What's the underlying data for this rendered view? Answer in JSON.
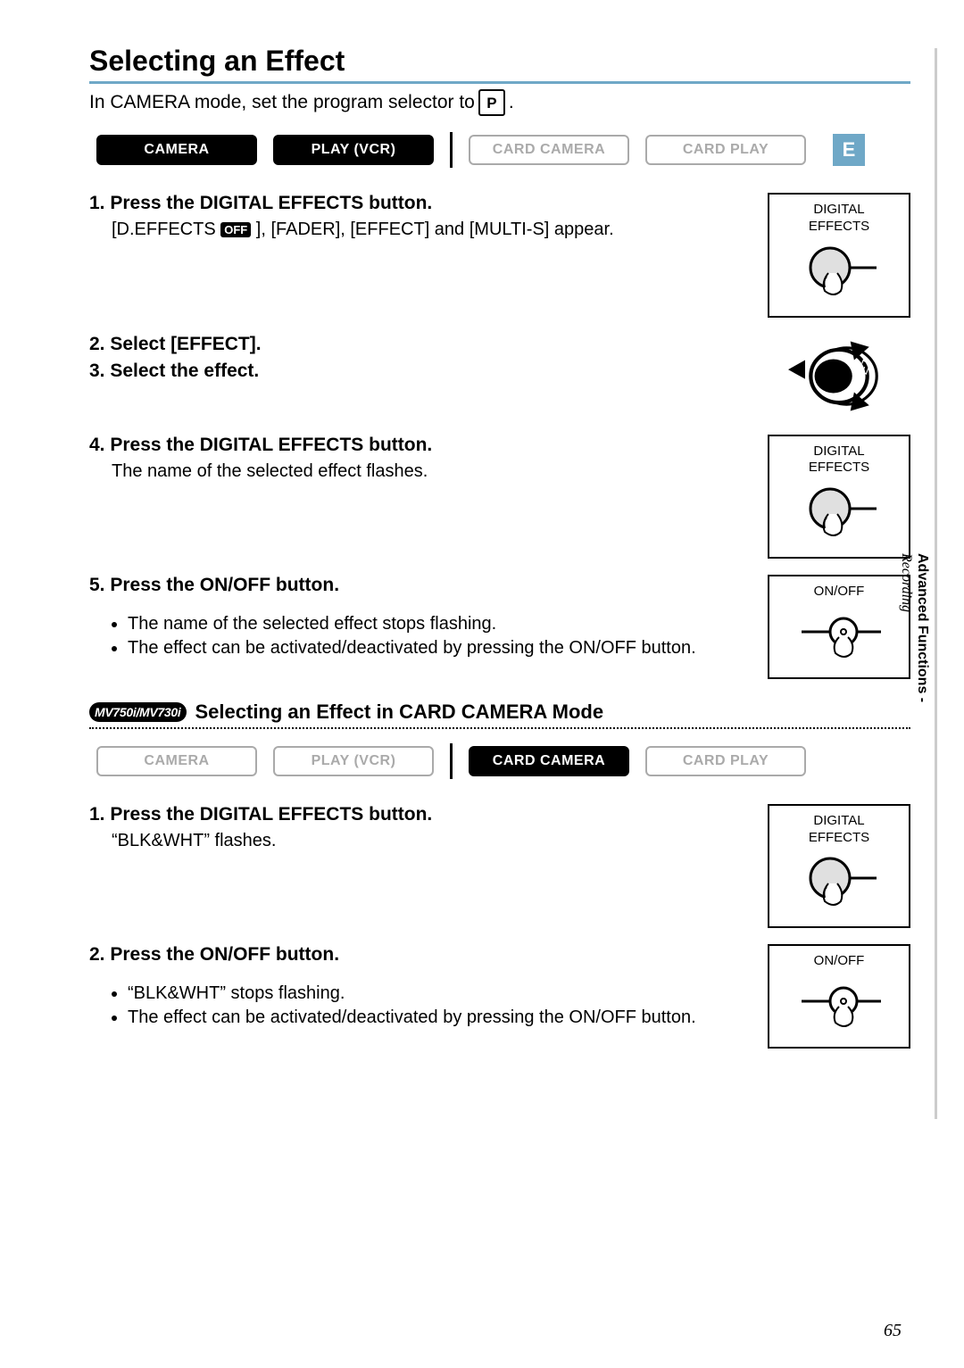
{
  "title": "Selecting an Effect",
  "intro_prefix": "In CAMERA mode, set the program selector to ",
  "intro_chip": "P",
  "intro_suffix": ".",
  "e_chip": "E",
  "modes_top": [
    {
      "label": "CAMERA",
      "active": true
    },
    {
      "label": "PLAY (VCR)",
      "active": true
    },
    {
      "label": "CARD CAMERA",
      "active": false
    },
    {
      "label": "CARD PLAY",
      "active": false
    }
  ],
  "steps_top": [
    {
      "num": "1.",
      "head": "Press the DIGITAL EFFECTS button.",
      "desc_prefix": "[D.EFFECTS ",
      "desc_off": "OFF",
      "desc_suffix": " ], [FADER], [EFFECT] and [MULTI-S] appear.",
      "illus": {
        "label1": "DIGITAL",
        "label2": "EFFECTS",
        "type": "press"
      }
    },
    {
      "num": "2.",
      "head": "Select [EFFECT]."
    },
    {
      "num": "3.",
      "head": "Select the effect.",
      "illus": {
        "type": "dial"
      }
    },
    {
      "num": "4.",
      "head": "Press the DIGITAL EFFECTS button.",
      "desc": "The name of the selected effect flashes.",
      "illus": {
        "label1": "DIGITAL",
        "label2": "EFFECTS",
        "type": "press"
      }
    },
    {
      "num": "5.",
      "head": "Press the ON/OFF button.",
      "bullets": [
        "The name of the selected effect stops flashing.",
        "The effect can be activated/deactivated by pressing the ON/OFF button."
      ],
      "illus": {
        "label1": "ON/OFF",
        "type": "press-small"
      }
    }
  ],
  "sub_model": "MV750i/MV730i",
  "sub_heading": "Selecting an Effect in CARD CAMERA Mode",
  "modes_bottom": [
    {
      "label": "CAMERA",
      "active": false
    },
    {
      "label": "PLAY (VCR)",
      "active": false
    },
    {
      "label": "CARD CAMERA",
      "active": true
    },
    {
      "label": "CARD PLAY",
      "active": false
    }
  ],
  "steps_bottom": [
    {
      "num": "1.",
      "head": "Press the DIGITAL EFFECTS button.",
      "desc": "“BLK&WHT” flashes.",
      "illus": {
        "label1": "DIGITAL",
        "label2": "EFFECTS",
        "type": "press"
      }
    },
    {
      "num": "2.",
      "head": "Press the ON/OFF button.",
      "bullets": [
        "“BLK&WHT” stops flashing.",
        "The effect can be activated/deactivated by pressing the ON/OFF button."
      ],
      "illus": {
        "label1": "ON/OFF",
        "type": "press-small"
      }
    }
  ],
  "side": {
    "category": "Recording",
    "section": "Advanced Functions -"
  },
  "page_number": "65"
}
